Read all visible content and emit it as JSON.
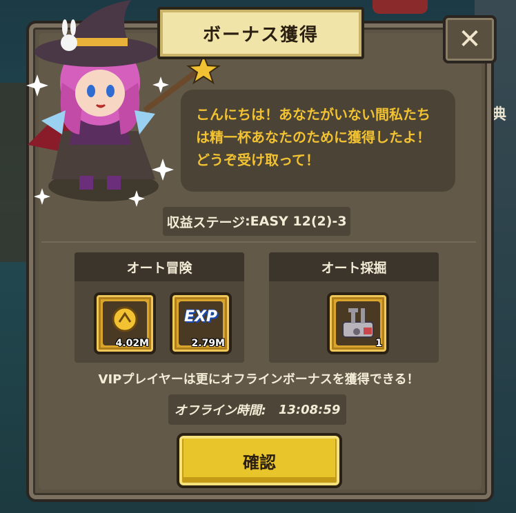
{
  "dialog": {
    "title": "ボーナス獲得",
    "close_label": "✕",
    "message": "こんにちは！あなたがいない間私たちは精一杯あなたのために獲得したよ！どうぞ受け取って！",
    "stage_label": "収益ステージ",
    "stage_value": ":EASY 12(2)-3",
    "auto_adventure": {
      "header": "オート冒険",
      "rewards": [
        {
          "icon": "gold-coin-icon",
          "qty": "4.02M"
        },
        {
          "icon": "exp-icon",
          "label": "EXP",
          "qty": "2.79M"
        }
      ]
    },
    "auto_mining": {
      "header": "オート採掘",
      "rewards": [
        {
          "icon": "mining-machine-icon",
          "qty": "1"
        }
      ]
    },
    "vip_note": "VIPプレイヤーは更にオフラインボーナスを獲得できる！",
    "offline_label": "オフライン時間:",
    "offline_time": "13:08:59",
    "confirm_label": "確認"
  },
  "background": {
    "glyph": "典"
  },
  "colors": {
    "panel": "#5c5344",
    "message_text": "#f2c232",
    "title_plate": "#f1e4a8",
    "confirm_button": "#e8c52a"
  }
}
